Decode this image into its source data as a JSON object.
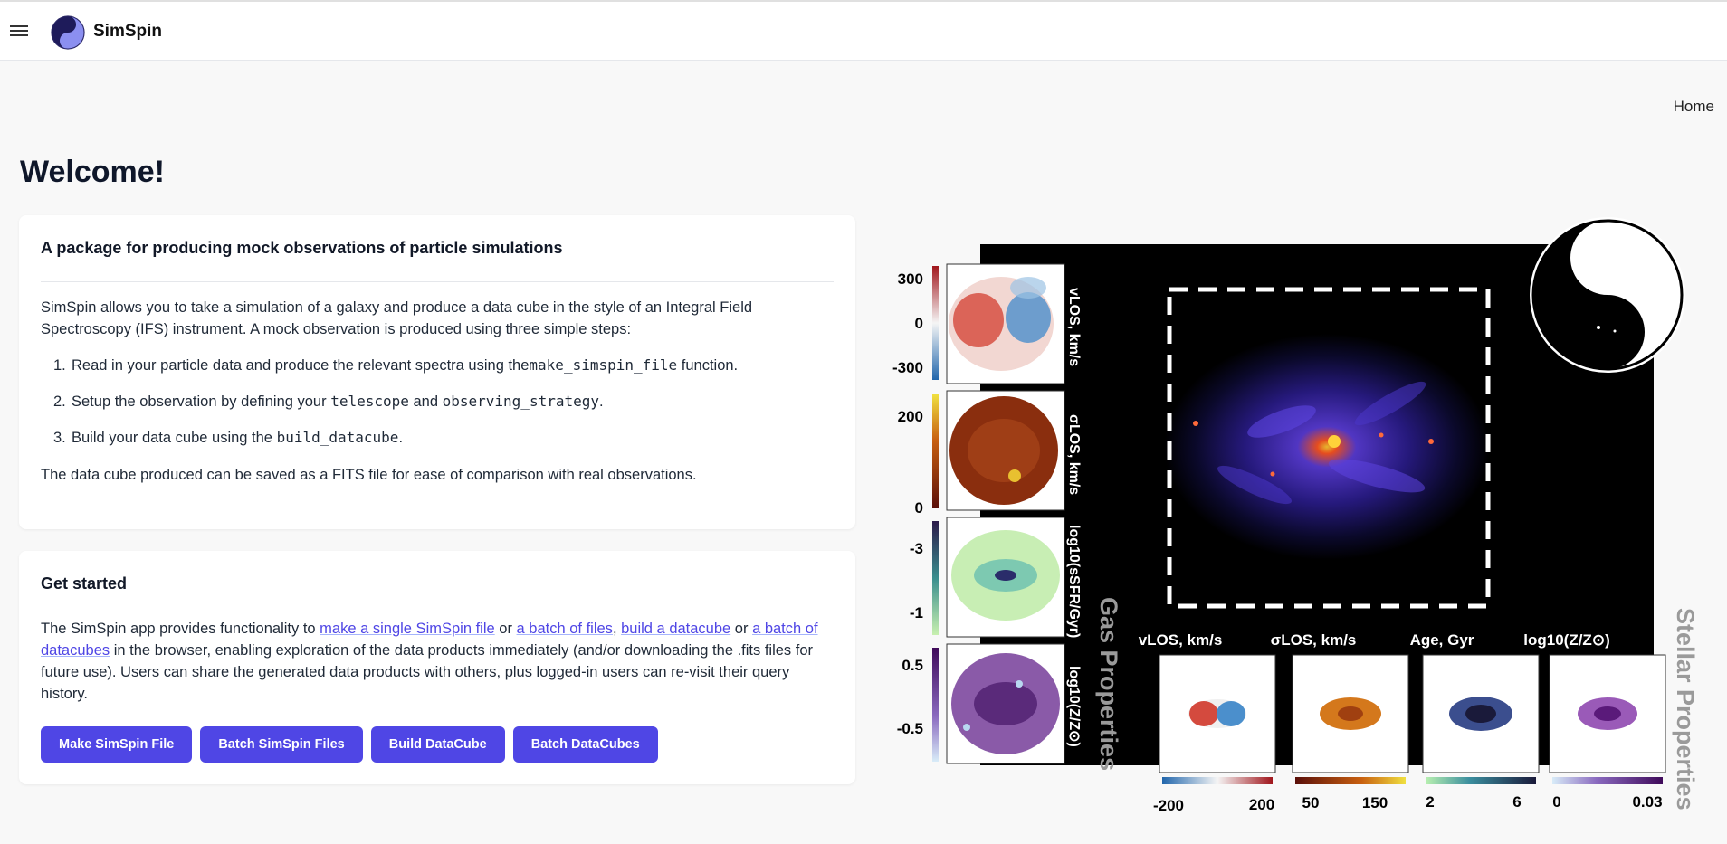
{
  "header": {
    "app_name": "SimSpin",
    "logo_icon": "simspin-logo-icon",
    "menu_icon": "hamburger-icon"
  },
  "nav": {
    "home": "Home"
  },
  "page_title": "Welcome!",
  "intro": {
    "title": "A package for producing mock observations of particle simulations",
    "description": "SimSpin allows you to take a simulation of a galaxy and produce a data cube in the style of an Integral Field Spectroscopy (IFS) instrument. A mock observation is produced using three simple steps:",
    "steps": [
      {
        "num": "1.",
        "before": "Read in your particle data and produce the relevant spectra using the",
        "code1": "make_simspin_file",
        "mid": "",
        "code2": "",
        "after": " function."
      },
      {
        "num": "2.",
        "before": "Setup the observation by defining your ",
        "code1": "telescope",
        "mid": " and ",
        "code2": "observing_strategy",
        "after": "."
      },
      {
        "num": "3.",
        "before": "Build your data cube using the ",
        "code1": "build_datacube",
        "mid": "",
        "code2": "",
        "after": "."
      }
    ],
    "footer": "The data cube produced can be saved as a FITS file for ease of comparison with real observations."
  },
  "get_started": {
    "title": "Get started",
    "text_1": "The SimSpin app provides functionality to ",
    "link_single": "make a single SimSpin file",
    "text_2": " or ",
    "link_batch_files": "a batch of files",
    "text_3": ", ",
    "link_datacube": "build a datacube",
    "text_4": " or ",
    "link_batch_datacubes": "a batch of datacubes",
    "text_5": " in the browser, enabling exploration of the data products immediately (and/or downloading the .fits files for future use). Users can share the generated data products with others, plus logged-in users can re-visit their query history.",
    "buttons": {
      "make_file": "Make SimSpin File",
      "batch_files": "Batch SimSpin Files",
      "build_datacube": "Build DataCube",
      "batch_datacubes": "Batch DataCubes"
    },
    "accent_color": "#4f46e5"
  },
  "illustration": {
    "gas_properties_label": "Gas Properties",
    "stellar_properties_label": "Stellar Properties",
    "gas_panels": [
      {
        "label": "vLOS, km/s",
        "ticks": [
          "300",
          "0",
          "-300"
        ]
      },
      {
        "label": "σLOS, km/s",
        "ticks": [
          "200",
          "0"
        ]
      },
      {
        "label": "log10(sSFR/Gyr)",
        "ticks": [
          "-3",
          "-1"
        ]
      },
      {
        "label": "log10(Z/Z⊙)",
        "ticks": [
          "0.5",
          "-0.5"
        ]
      }
    ],
    "stellar_panels": [
      {
        "label": "vLOS, km/s",
        "ticks": [
          "-200",
          "200"
        ]
      },
      {
        "label": "σLOS, km/s",
        "ticks": [
          "50",
          "150"
        ]
      },
      {
        "label": "Age, Gyr",
        "ticks": [
          "2",
          "6"
        ]
      },
      {
        "label": "log10(Z/Z⊙)",
        "ticks": [
          "0",
          "0.03"
        ]
      }
    ]
  }
}
